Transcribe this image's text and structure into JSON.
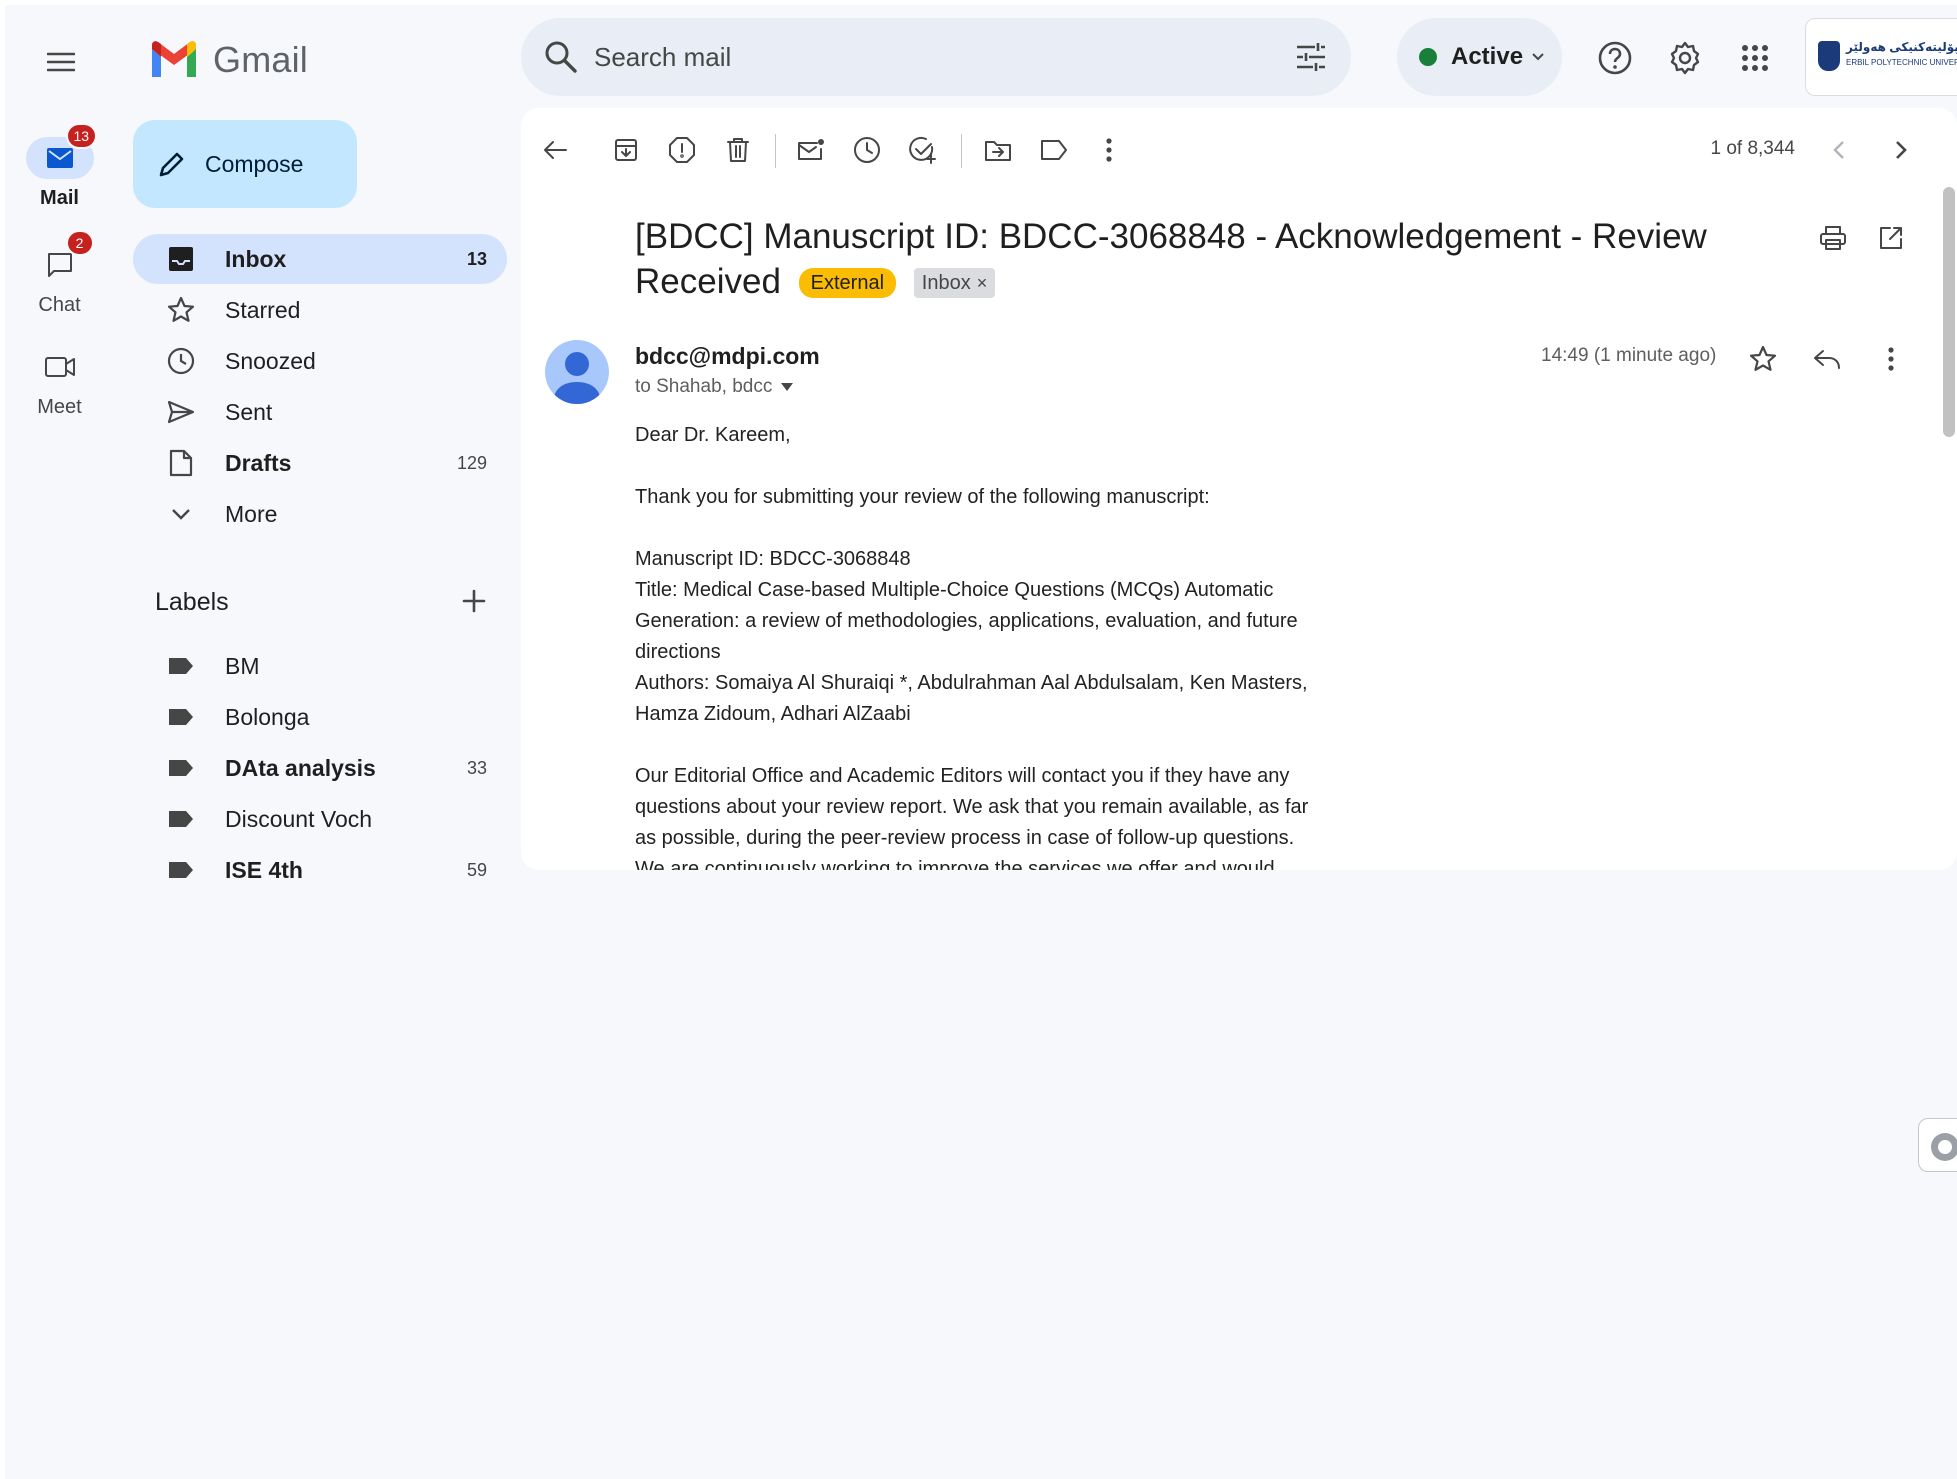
{
  "app": {
    "name": "Gmail"
  },
  "search": {
    "placeholder": "Search mail"
  },
  "status": {
    "label": "Active",
    "color": "#188038"
  },
  "org_logo": {
    "arabic_text": "زانکۆی پۆلیتەکنیکی هەولێر",
    "english_text": "ERBIL POLYTECHNIC UNIVERSITY"
  },
  "rail": [
    {
      "label": "Mail",
      "badge": "13",
      "icon": "mail-icon",
      "active": true
    },
    {
      "label": "Chat",
      "badge": "2",
      "icon": "chat-icon"
    },
    {
      "label": "Meet",
      "badge": "",
      "icon": "video-icon"
    }
  ],
  "sidebar": {
    "compose": "Compose",
    "folders": [
      {
        "label": "Inbox",
        "count": "13",
        "icon": "inbox-icon",
        "selected": true,
        "bold": true
      },
      {
        "label": "Starred",
        "count": "",
        "icon": "star-icon"
      },
      {
        "label": "Snoozed",
        "count": "",
        "icon": "clock-icon"
      },
      {
        "label": "Sent",
        "count": "",
        "icon": "send-icon"
      },
      {
        "label": "Drafts",
        "count": "129",
        "icon": "draft-icon",
        "bold": true
      },
      {
        "label": "More",
        "count": "",
        "icon": "chevron-down-icon"
      }
    ],
    "labels_heading": "Labels",
    "labels": [
      {
        "label": "BM",
        "count": ""
      },
      {
        "label": "Bolonga",
        "count": ""
      },
      {
        "label": "DAta analysis",
        "count": "33",
        "bold": true
      },
      {
        "label": "Discount Voch",
        "count": ""
      },
      {
        "label": "ISE 4th",
        "count": "59",
        "bold": true
      }
    ]
  },
  "toolbar": {
    "pager": "1 of 8,344"
  },
  "email": {
    "subject": "[BDCC] Manuscript ID: BDCC-3068848 - Acknowledgement - Review Received",
    "chips": {
      "external": "External",
      "inbox": "Inbox",
      "inbox_remove": "×"
    },
    "sender": "bdcc@mdpi.com",
    "recipients": "to Shahab, bdcc",
    "time": "14:49 (1 minute ago)",
    "body": {
      "greeting": "Dear Dr. Kareem,",
      "p1": "Thank you for submitting your review of the following manuscript:",
      "manuscript_id": "Manuscript ID: BDCC-3068848",
      "title_l1": "Title: Medical Case-based Multiple-Choice Questions (MCQs) Automatic",
      "title_l2": "Generation: a review of methodologies, applications, evaluation, and future",
      "title_l3": "directions",
      "authors_l1": "Authors: Somaiya Al Shuraiqi *, Abdulrahman Aal Abdulsalam, Ken Masters,",
      "authors_l2": "Hamza Zidoum, Adhari AlZaabi",
      "p3_l1": "Our Editorial Office and Academic Editors will contact you if they have any",
      "p3_l2": "questions about your review report. We ask that you remain available, as far",
      "p3_l3": "as possible, during the peer-review process in case of follow-up questions.",
      "p3_l4": "We are continuously working to improve the services we offer and would"
    }
  },
  "colors": {
    "accent": "#0b57d0",
    "selected_bg": "#d3e3fd",
    "compose_bg": "#c2e7ff",
    "external_chip": "#fbbc04"
  }
}
